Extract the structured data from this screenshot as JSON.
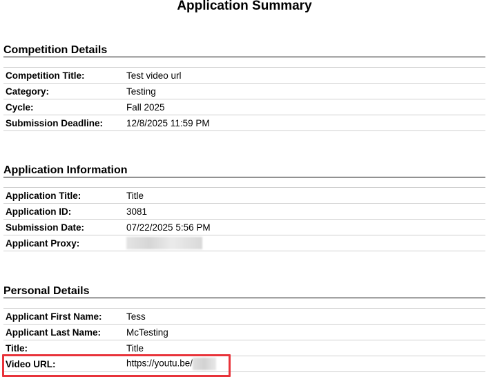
{
  "document": {
    "title": "Application Summary"
  },
  "competition_details": {
    "heading": "Competition Details",
    "rows": [
      {
        "label": "Competition Title:",
        "value": "Test video url"
      },
      {
        "label": "Category:",
        "value": "Testing"
      },
      {
        "label": "Cycle:",
        "value": "Fall 2025"
      },
      {
        "label": "Submission Deadline:",
        "value": "12/8/2025 11:59 PM"
      }
    ]
  },
  "application_information": {
    "heading": "Application Information",
    "rows": [
      {
        "label": "Application Title:",
        "value": "Title"
      },
      {
        "label": "Application ID:",
        "value": "3081"
      },
      {
        "label": "Submission Date:",
        "value": "07/22/2025 5:56 PM"
      },
      {
        "label": "Applicant Proxy:",
        "value": ""
      }
    ]
  },
  "personal_details": {
    "heading": "Personal Details",
    "rows": [
      {
        "label": "Applicant First Name:",
        "value": "Tess"
      },
      {
        "label": "Applicant Last Name:",
        "value": "McTesting"
      },
      {
        "label": "Title:",
        "value": "Title"
      },
      {
        "label": "Video URL:",
        "value": "https://youtu.be/"
      }
    ]
  },
  "highlight": {
    "color": "#e8333a"
  }
}
